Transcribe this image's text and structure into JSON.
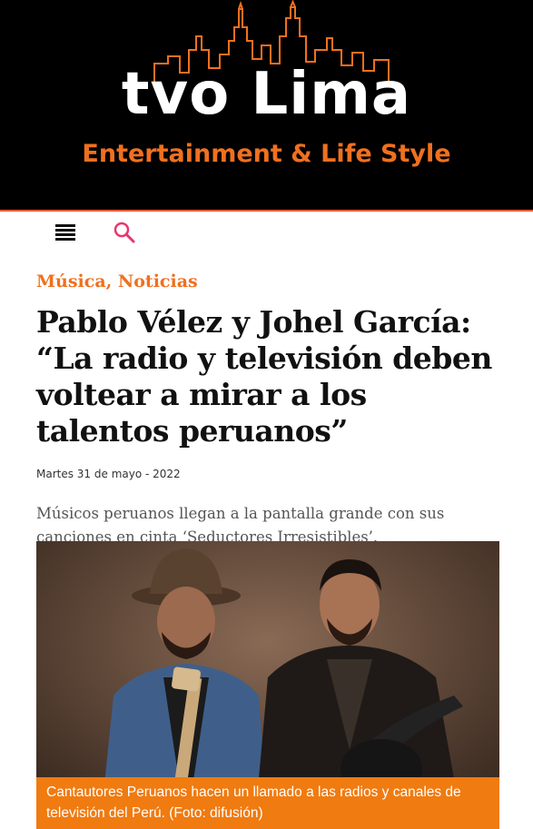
{
  "brand": {
    "logo_text": "tvo Lima",
    "tagline": "Entertainment & Life Style"
  },
  "nav": {
    "menu_icon": "hamburger-icon",
    "search_icon": "search-icon"
  },
  "article": {
    "categories": [
      "Música",
      "Noticias"
    ],
    "category_separator": ",",
    "title": "Pablo Vélez y Johel García: “La radio y televisión deben voltear a mirar a los talentos peruanos”",
    "date": "Martes 31 de mayo - 2022",
    "summary": "Músicos peruanos llegan a la pantalla grande con sus canciones en cinta ‘Seductores Irresistibles’.",
    "photo_caption": "Cantautores Peruanos hacen un llamado a las radios y canales de televisión del Perú. (Foto: difusión)"
  },
  "colors": {
    "accent": "#f0701e",
    "header_bg": "#000000",
    "caption_bg": "#f07b10"
  }
}
